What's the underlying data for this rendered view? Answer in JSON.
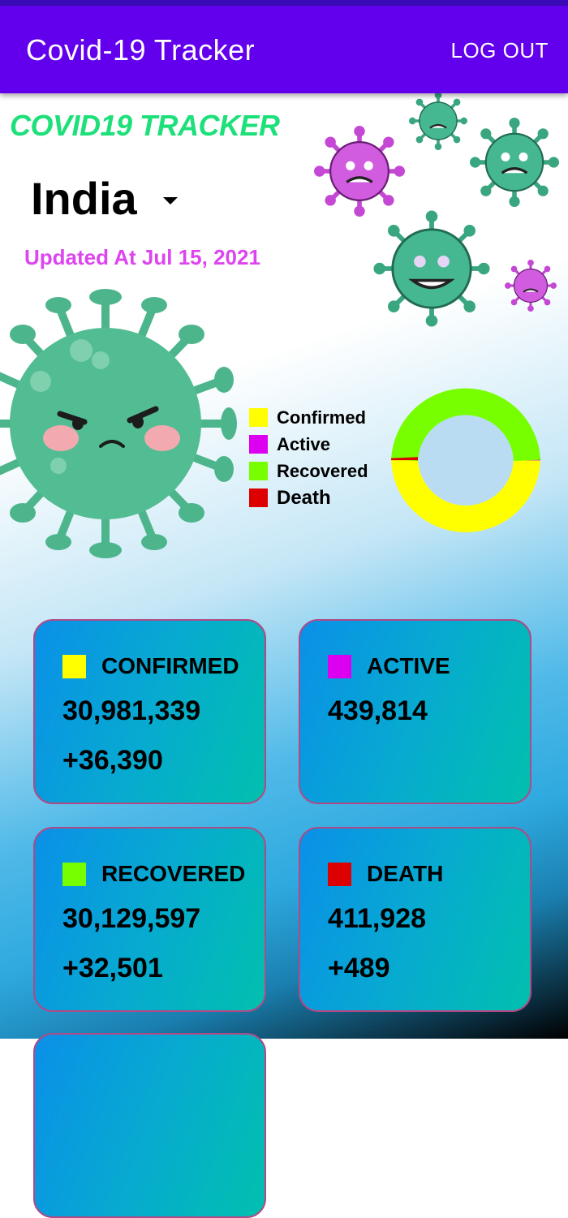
{
  "app_bar": {
    "title": "Covid-19 Tracker",
    "logout_label": "LOG OUT"
  },
  "brand": "COVID19 TRACKER",
  "country": {
    "selected": "India"
  },
  "updated": "Updated At Jul 15, 2021",
  "legend": [
    {
      "label": "Confirmed",
      "color": "#ffff00"
    },
    {
      "label": "Active",
      "color": "#dd00f0"
    },
    {
      "label": "Recovered",
      "color": "#77ff00"
    },
    {
      "label": "Death",
      "color": "#dd0000"
    }
  ],
  "cards": {
    "confirmed": {
      "title": "CONFIRMED",
      "total": "30,981,339",
      "delta": "+36,390",
      "color": "#ffff00"
    },
    "active": {
      "title": "ACTIVE",
      "total": "439,814",
      "delta": "",
      "color": "#dd00f0"
    },
    "recovered": {
      "title": "RECOVERED",
      "total": "30,129,597",
      "delta": "+32,501",
      "color": "#77ff00"
    },
    "death": {
      "title": "DEATH",
      "total": "411,928",
      "delta": "+489",
      "color": "#dd0000"
    }
  },
  "chart_data": {
    "type": "pie",
    "categories": [
      "Confirmed",
      "Active",
      "Recovered",
      "Death"
    ],
    "values": [
      30981339,
      439814,
      30129597,
      411928
    ],
    "colors": [
      "#ffff00",
      "#dd00f0",
      "#77ff00",
      "#dd0000"
    ],
    "legend": "left"
  }
}
